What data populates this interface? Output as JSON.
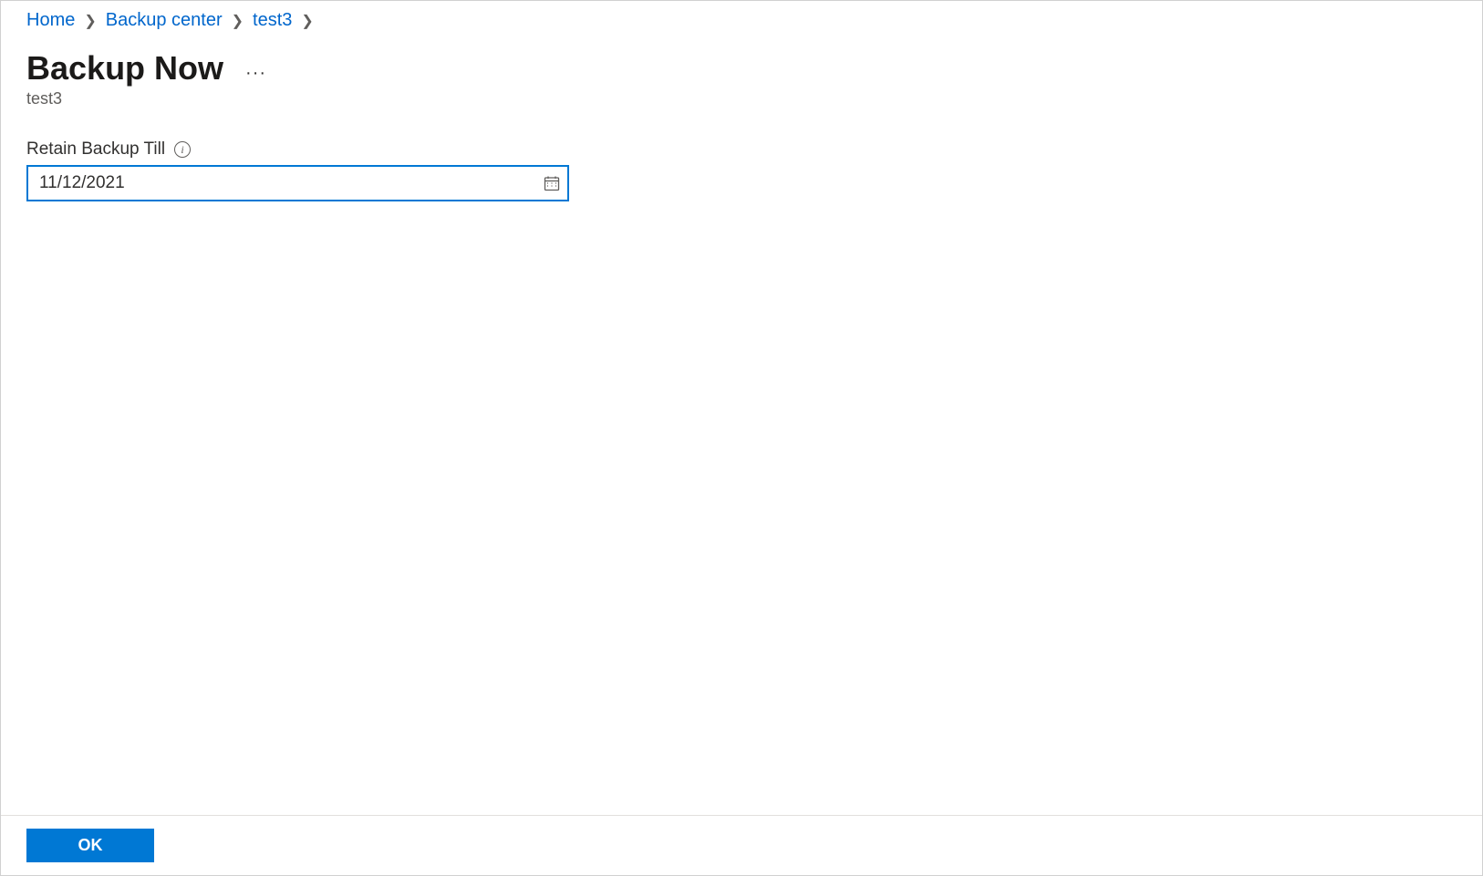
{
  "breadcrumb": {
    "items": [
      {
        "label": "Home"
      },
      {
        "label": "Backup center"
      },
      {
        "label": "test3"
      }
    ]
  },
  "header": {
    "title": "Backup Now",
    "subtitle": "test3"
  },
  "form": {
    "retain_label": "Retain Backup Till",
    "date_value": "11/12/2021"
  },
  "footer": {
    "ok_label": "OK"
  }
}
